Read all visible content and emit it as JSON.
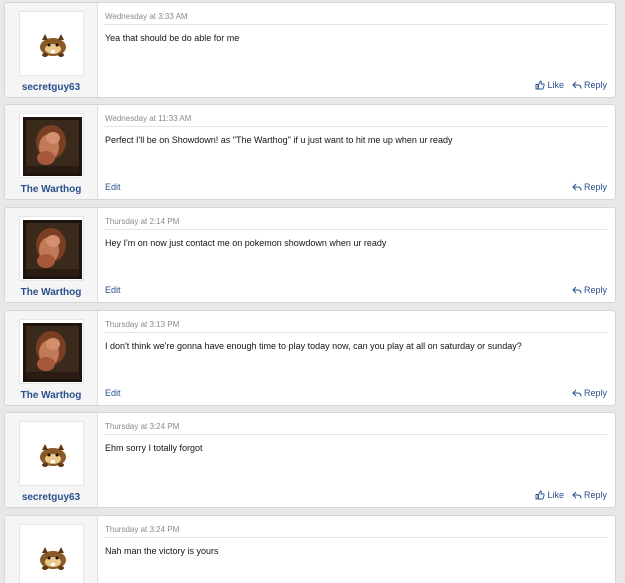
{
  "actions": {
    "like": "Like",
    "reply": "Reply",
    "edit": "Edit"
  },
  "colors": {
    "username": "#2a4f8c",
    "link": "#2a4f8c",
    "date": "#8a8a8a"
  },
  "posts": [
    {
      "author": "secretguy63",
      "avatar": "bidoof-sprite",
      "date": "Wednesday at 3:33 AM",
      "text": "Yea that should be do able for me",
      "own": false
    },
    {
      "author": "The Warthog",
      "avatar": "warthog-photo",
      "date": "Wednesday at 11:33 AM",
      "text": "Perfect I'll be on Showdown! as \"The Warthog\" if u just want to hit me up when ur ready",
      "own": true
    },
    {
      "author": "The Warthog",
      "avatar": "warthog-photo",
      "date": "Thursday at 2:14 PM",
      "text": "Hey I'm on now just contact me on pokemon showdown when ur ready",
      "own": true
    },
    {
      "author": "The Warthog",
      "avatar": "warthog-photo",
      "date": "Thursday at 3:13 PM",
      "text": "I don't think we're gonna have enough time to play today now, can you play at all on saturday or sunday?",
      "own": true
    },
    {
      "author": "secretguy63",
      "avatar": "bidoof-sprite",
      "date": "Thursday at 3:24 PM",
      "text": "Ehm sorry I totally forgot",
      "own": false
    },
    {
      "author": "secretguy63",
      "avatar": "bidoof-sprite",
      "date": "Thursday at 3:24 PM",
      "text": "Nah man the victory is yours",
      "own": false
    }
  ]
}
